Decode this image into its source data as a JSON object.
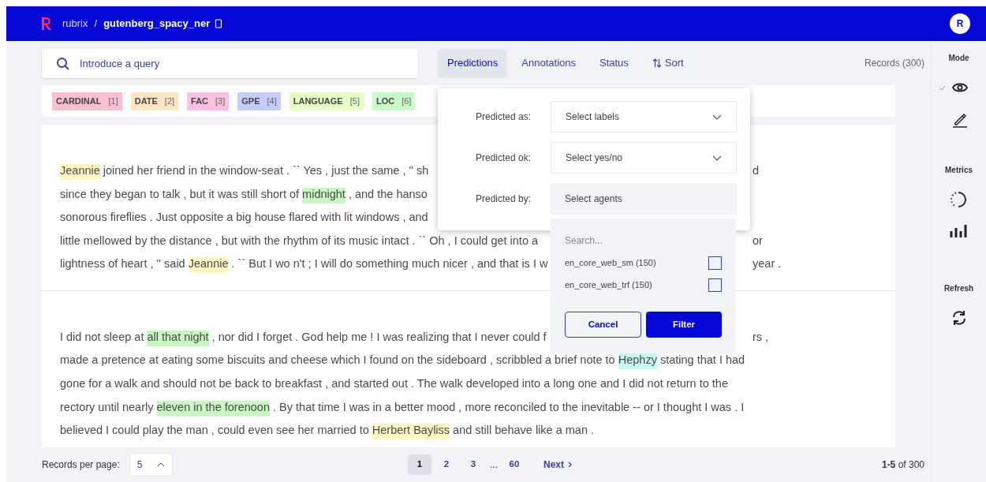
{
  "header": {
    "app": "rubrix",
    "separator": "/",
    "dataset": "gutenberg_spacy_ner"
  },
  "avatar": "R",
  "search": {
    "placeholder": "Introduce a query"
  },
  "filter_tabs": [
    {
      "label": "Predictions",
      "selected": true
    },
    {
      "label": "Annotations",
      "selected": false
    },
    {
      "label": "Status",
      "selected": false
    },
    {
      "label": "Sort",
      "selected": false,
      "kind": "sort"
    }
  ],
  "records_count": "Records (300)",
  "labels": [
    {
      "name": "CARDINAL",
      "key": "[1]",
      "color": "#fdc0d0"
    },
    {
      "name": "DATE",
      "key": "[2]",
      "color": "#fee5c3"
    },
    {
      "name": "FAC",
      "key": "[3]",
      "color": "#fdc0e0"
    },
    {
      "name": "GPE",
      "key": "[4]",
      "color": "#c4cdfc"
    },
    {
      "name": "LANGUAGE",
      "key": "[5]",
      "color": "#e6fdc6"
    },
    {
      "name": "LOC",
      "key": "[6]",
      "color": "#c9fbc8"
    }
  ],
  "records": [
    {
      "lines": [
        {
          "left": [
            {
              "text": "Jeannie",
              "color": "#fff8c4"
            },
            {
              "text": " joined her friend in the window-seat . `` Yes , just the same , '' sh"
            }
          ],
          "right": "d"
        },
        {
          "left": [
            {
              "text": "since they began to talk , but it was still short of "
            },
            {
              "text": "midnight",
              "color": "#c8f7c2"
            },
            {
              "text": " , and the hanso"
            }
          ]
        },
        {
          "left": [
            {
              "text": "sonorous fireflies . Just opposite a big house flared with lit windows , and"
            }
          ]
        },
        {
          "left": [
            {
              "text": "little mellowed by the distance , but with the rhythm of its music intact . `` Oh , I could get into a"
            }
          ],
          "right": "or"
        },
        {
          "left": [
            {
              "text": "lightness of heart , '' said "
            },
            {
              "text": "Jeannie",
              "color": "#fff8c4"
            },
            {
              "text": " . `` But I wo n't ; I will do something much nicer , and that is I w"
            }
          ],
          "right": "year ."
        }
      ]
    },
    {
      "lines": [
        {
          "left": [
            {
              "text": "I did not sleep at "
            },
            {
              "text": "all that night",
              "color": "#c8f7c2"
            },
            {
              "text": " , nor did I forget . God help me ! I was realizing that I never could f"
            }
          ],
          "right": "rs ,"
        },
        {
          "left": [
            {
              "text": "made a pretence at eating some biscuits and cheese which I found on the sideboard , scribbled a brief note to "
            },
            {
              "text": "Hephzy",
              "color": "#c6f8f4"
            },
            {
              "text": " stating that I had"
            }
          ]
        },
        {
          "left": [
            {
              "text": "gone for a walk and should not be back to breakfast , and started out . The walk developed into a long one and I did not return to the"
            }
          ]
        },
        {
          "left": [
            {
              "text": "rectory until nearly "
            },
            {
              "text": "eleven in the forenoon",
              "color": "#c8f7c2"
            },
            {
              "text": " . By that time I was in a better mood , more reconciled to the inevitable -- or I thought I was . I"
            }
          ]
        },
        {
          "left": [
            {
              "text": "believed I could play the man , could even see her married to "
            },
            {
              "text": "Herbert Bayliss",
              "color": "#fff8c4"
            },
            {
              "text": " and still behave like a man ."
            }
          ]
        }
      ]
    }
  ],
  "popover": {
    "fields": [
      {
        "label": "Predicted as:",
        "placeholder": "Select labels",
        "kind": "dropdown"
      },
      {
        "label": "Predicted ok:",
        "placeholder": "Select yes/no",
        "kind": "dropdown"
      },
      {
        "label": "Predicted by:",
        "placeholder": "Select agents",
        "kind": "open"
      }
    ],
    "agents": {
      "search_placeholder": "Search...",
      "options": [
        {
          "label": "en_core_web_sm (150)",
          "checked": false
        },
        {
          "label": "en_core_web_trf (150)",
          "checked": false
        }
      ],
      "cancel": "Cancel",
      "filter": "Filter"
    }
  },
  "sidebar": {
    "sections": [
      {
        "title": "Mode",
        "items": [
          {
            "kind": "view",
            "selected": true
          },
          {
            "kind": "annotate",
            "selected": false
          }
        ]
      },
      {
        "title": "Metrics",
        "items": [
          {
            "kind": "progress"
          },
          {
            "kind": "stats"
          }
        ]
      },
      {
        "title": "Refresh",
        "items": [
          {
            "kind": "refresh"
          }
        ]
      }
    ]
  },
  "footer": {
    "per_page_label": "Records per page:",
    "per_page": "5",
    "pages": [
      {
        "label": "1",
        "selected": true
      },
      {
        "label": "2",
        "selected": false
      },
      {
        "label": "3",
        "selected": false
      },
      {
        "label": "...",
        "kind": "ellipsis"
      },
      {
        "label": "60",
        "selected": false
      }
    ],
    "next": "Next",
    "range_bold": "1-5",
    "range_rest": " of 300"
  }
}
